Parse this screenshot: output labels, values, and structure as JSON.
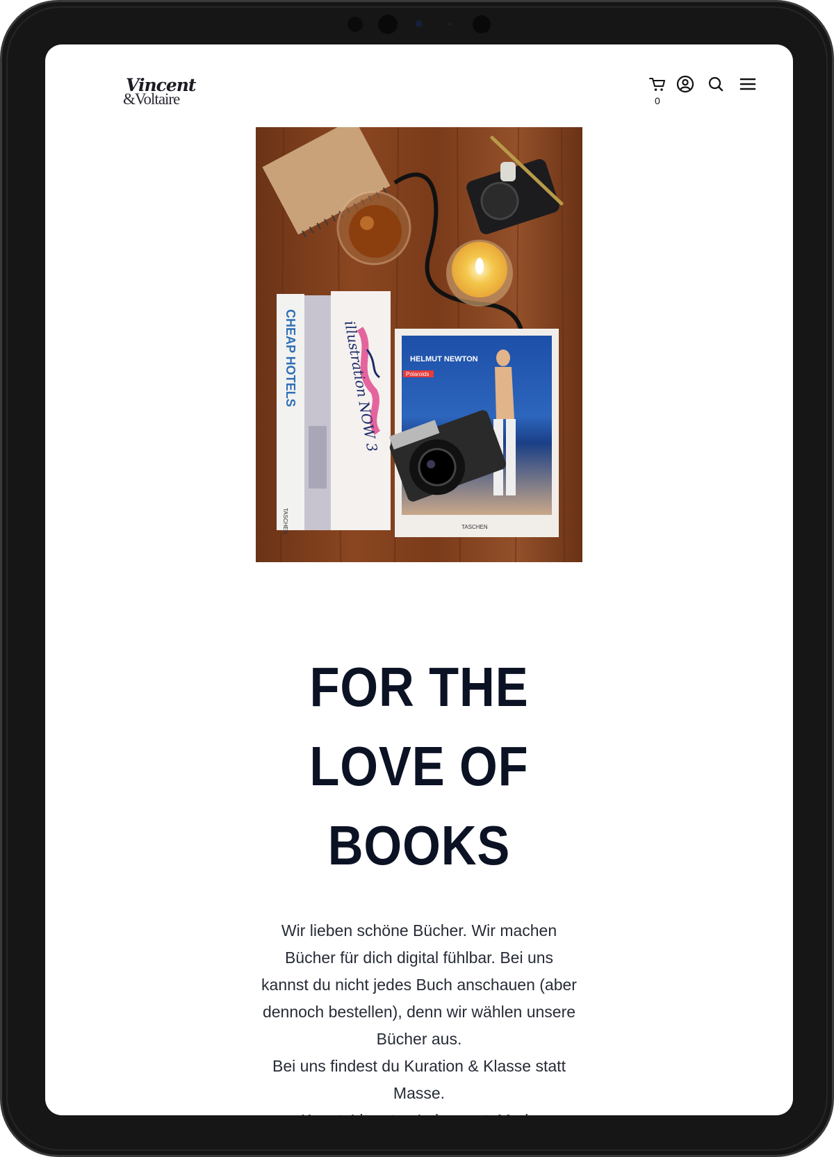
{
  "brand": {
    "logo_line1": "Vincent",
    "logo_line2": "&Voltaire"
  },
  "header": {
    "cart_count": "0",
    "icons": [
      "cart-icon",
      "account-icon",
      "search-icon",
      "menu-icon"
    ]
  },
  "hero": {
    "image_texts": {
      "spine1": "CHEAP HOTELS",
      "spine1_publisher": "TASCHEN",
      "spine3": "illustration NOW 3",
      "cover_title": "HELMUT NEWTON",
      "cover_sub": "Polaroids",
      "cover_publisher": "TASCHEN"
    }
  },
  "main": {
    "headline_line1": "FOR THE",
    "headline_line2": "LOVE OF",
    "headline_line3": "BOOKS",
    "intro_para1": "Wir lieben schöne Bücher. Wir machen Bücher für dich digital fühlbar. Bei uns kannst du nicht jedes Buch anschauen (aber dennoch bestellen), denn wir wählen unsere Bücher aus.",
    "intro_para2": "Bei uns findest du Kuration & Klasse statt Masse.",
    "intro_para3_cut": "Kunst, Literatur, Lebensart, Mode"
  },
  "colors": {
    "headline": "#0b1224",
    "body_text": "#262b36",
    "device_frame": "#161616",
    "wood": "#7a3d1c"
  }
}
